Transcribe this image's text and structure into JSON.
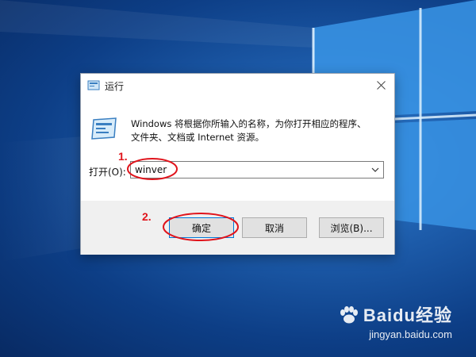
{
  "dialog": {
    "title": "运行",
    "description_line1": "Windows 将根据你所输入的名称，为你打开相应的程序、",
    "description_line2": "文件夹、文档或 Internet 资源。",
    "open_label": "打开(O):",
    "combo_value": "winver",
    "buttons": {
      "ok": "确定",
      "cancel": "取消",
      "browse": "浏览(B)..."
    }
  },
  "annotations": {
    "step1": "1.",
    "step2": "2.",
    "color": "#e0141c"
  },
  "watermark": {
    "brand": "Baidu经验",
    "url": "jingyan.baidu.com"
  },
  "icons": [
    "run-app-icon",
    "close-icon",
    "dropdown-arrow-icon",
    "windows-logo-icon",
    "baidu-paw-icon"
  ],
  "colors": {
    "desktop": "#1c5aa8",
    "accent": "#0078d7",
    "footer": "#f0f0f0"
  }
}
